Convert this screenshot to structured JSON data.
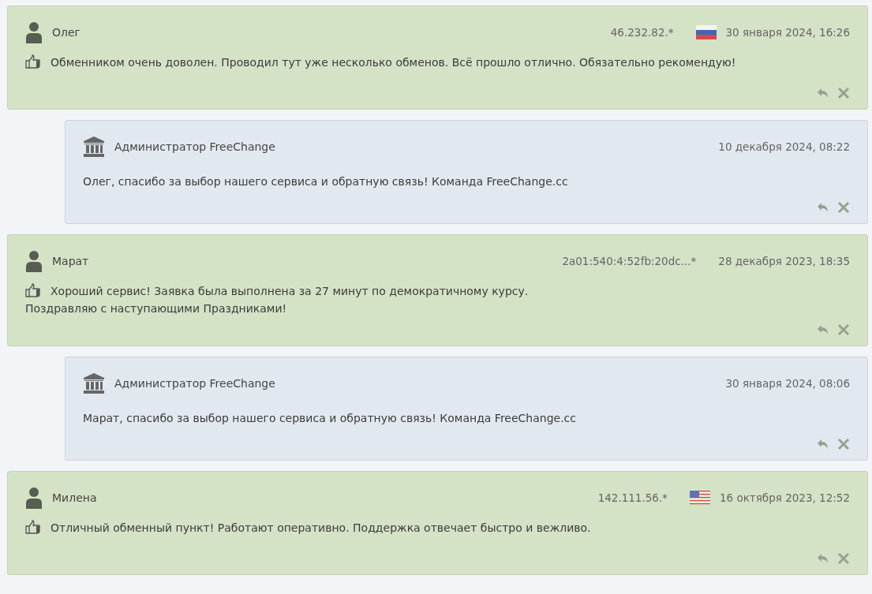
{
  "comments": [
    {
      "kind": "review",
      "author": "Олег",
      "ip": "46.232.82.*",
      "flag": {
        "kind": "ru"
      },
      "date": "30 января 2024, 16:26",
      "lines": [
        "Обменником очень доволен. Проводил тут уже несколько обменов. Всё прошло отлично. Обязательно рекомендую!"
      ]
    },
    {
      "kind": "reply",
      "author": "Администратор FreeChange",
      "date": "10 декабря 2024, 08:22",
      "lines": [
        "Олег, спасибо за выбор нашего сервиса и обратную связь! Команда FreeChange.cc"
      ]
    },
    {
      "kind": "review",
      "author": "Марат",
      "ip": "2a01:540:4:52fb:20dc...*",
      "date": "28 декабря 2023, 18:35",
      "lines": [
        "Хороший сервис! Заявка была выполнена за 27 минут по демократичному курсу.",
        "Поздравляю с наступающими Праздниками!"
      ]
    },
    {
      "kind": "reply",
      "author": "Администратор FreeChange",
      "date": "30 января 2024, 08:06",
      "lines": [
        "Марат, спасибо за выбор нашего сервиса и обратную связь! Команда FreeChange.cc"
      ]
    },
    {
      "kind": "review",
      "author": "Милена",
      "ip": "142.111.56.*",
      "flag": {
        "kind": "us"
      },
      "date": "16 октября 2023, 12:52",
      "lines": [
        "Отличный обменный пункт! Работают оперативно. Поддержка отвечает быстро и вежливо."
      ]
    }
  ]
}
